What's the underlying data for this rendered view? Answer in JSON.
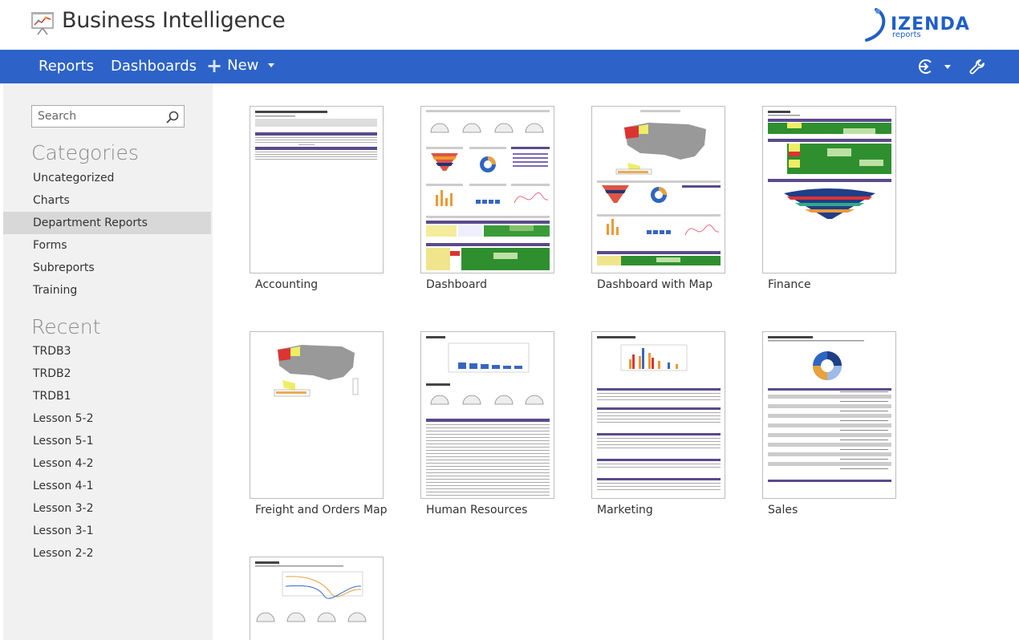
{
  "app": {
    "title": "Business Intelligence"
  },
  "brand": {
    "name": "IZENDA",
    "sub": "reports"
  },
  "nav": {
    "reports": "Reports",
    "dashboards": "Dashboards",
    "new": "New",
    "icons": [
      "login-icon",
      "wrench-icon"
    ]
  },
  "sidebar": {
    "search_placeholder": "Search",
    "categories_title": "Categories",
    "categories": [
      "Uncategorized",
      "Charts",
      "Department Reports",
      "Forms",
      "Subreports",
      "Training"
    ],
    "active_category": "Department Reports",
    "recent_title": "Recent",
    "recent": [
      "TRDB3",
      "TRDB2",
      "TRDB1",
      "Lesson 5-2",
      "Lesson 5-1",
      "Lesson 4-2",
      "Lesson 4-1",
      "Lesson 3-2",
      "Lesson 3-1",
      "Lesson 2-2"
    ]
  },
  "reports": [
    {
      "label": "Accounting",
      "thumb": "table"
    },
    {
      "label": "Dashboard",
      "thumb": "dashboard"
    },
    {
      "label": "Dashboard with Map",
      "thumb": "map-dashboard"
    },
    {
      "label": "Finance",
      "thumb": "finance"
    },
    {
      "label": "Freight and Orders Map",
      "thumb": "map"
    },
    {
      "label": "Human Resources",
      "thumb": "hr"
    },
    {
      "label": "Marketing",
      "thumb": "marketing"
    },
    {
      "label": "Sales",
      "thumb": "sales"
    },
    {
      "label": "",
      "thumb": "shipping"
    }
  ],
  "colors": {
    "nav": "#2d63c8",
    "sidebar": "#f1f1f1",
    "active": "#d8d8d8",
    "header_row": "#5b4a8c"
  }
}
